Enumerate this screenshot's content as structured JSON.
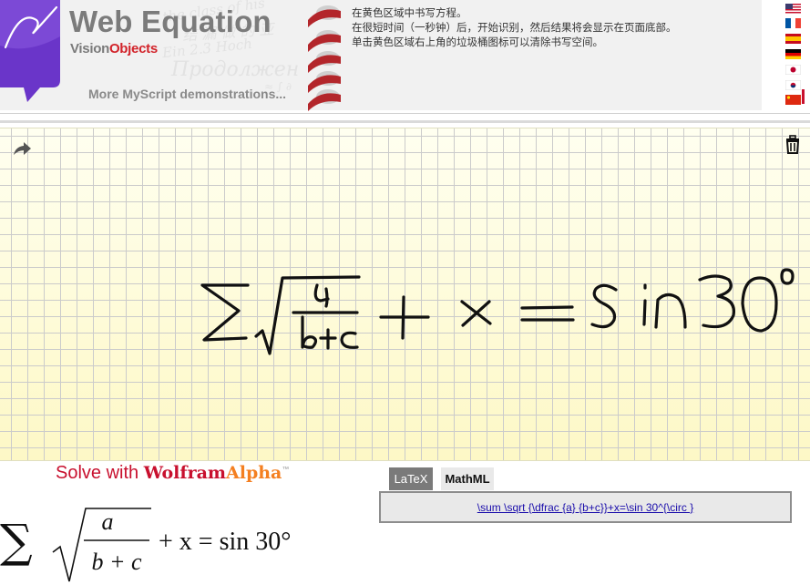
{
  "header": {
    "title": "Web Equation",
    "brand_part1": "Vision",
    "brand_part2": "Objects",
    "more_link": "More MyScript demonstrations...",
    "ghost_text": "Продолжен"
  },
  "instructions": [
    "在黄色区域中书写方程。",
    "在很短时间（一秒钟）后，开始识别，然后结果将会显示在页面底部。",
    "单击黄色区域右上角的垃圾桶图标可以清除书写空间。"
  ],
  "languages": [
    {
      "code": "en",
      "icon": "us-flag-icon"
    },
    {
      "code": "fr",
      "icon": "france-flag-icon"
    },
    {
      "code": "es",
      "icon": "spain-flag-icon"
    },
    {
      "code": "de",
      "icon": "germany-flag-icon"
    },
    {
      "code": "ja",
      "icon": "japan-flag-icon"
    },
    {
      "code": "ko",
      "icon": "korea-flag-icon"
    },
    {
      "code": "zh",
      "icon": "china-flag-icon"
    }
  ],
  "writing_area": {
    "undo_icon": "undo-arrow-icon",
    "trash_icon": "trash-icon"
  },
  "solve": {
    "prefix": "Solve with",
    "brand_part1": "Wolfram",
    "brand_part2": "Alpha",
    "brand_mark": "™"
  },
  "result": {
    "equation_text": "∑ √(a / (b + c)) + x = sin 30°",
    "numerator": "a",
    "denominator": "b + c",
    "rhs": "+ x = sin 30°"
  },
  "tabs": [
    {
      "label": "LaTeX",
      "active": true
    },
    {
      "label": "MathML",
      "active": false
    }
  ],
  "latex_output": "\\sum \\sqrt {\\dfrac {a} {b+c}}+x=\\sin 30^{\\circ }",
  "colors": {
    "accent_purple": "#6a35c9",
    "brand_red": "#d2232a",
    "wolfram_orange": "#f47f20",
    "writing_yellow": "#fdf8c6"
  }
}
